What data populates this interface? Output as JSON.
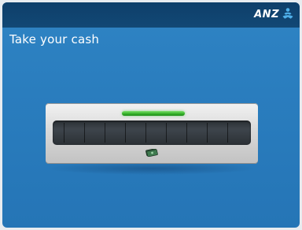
{
  "header": {
    "brand": "ANZ",
    "logo_icon": "anz-people-icon"
  },
  "screen": {
    "title": "Take your cash"
  },
  "dispenser": {
    "status_light": "green",
    "cash_icon": "cash-notes-icon"
  },
  "colors": {
    "background_blue": "#2a7dbe",
    "header_navy": "#124875",
    "status_green": "#37b32b"
  }
}
